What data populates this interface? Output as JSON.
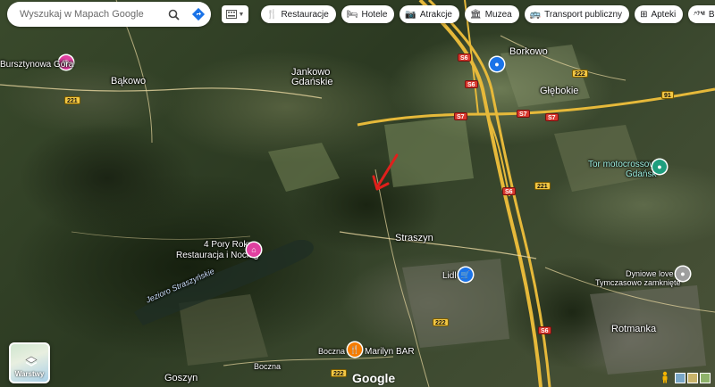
{
  "search": {
    "placeholder": "Wyszukaj w Mapach Google"
  },
  "chips": [
    {
      "label": "Restauracje",
      "icon": "fork-knife-icon"
    },
    {
      "label": "Hotele",
      "icon": "bed-icon"
    },
    {
      "label": "Atrakcje",
      "icon": "camera-icon"
    },
    {
      "label": "Muzea",
      "icon": "museum-icon"
    },
    {
      "label": "Transport publiczny",
      "icon": "bus-icon"
    },
    {
      "label": "Apteki",
      "icon": "pharmacy-icon"
    },
    {
      "label": "B",
      "icon": "atm-icon",
      "prefix": "ATM"
    }
  ],
  "places": {
    "bursztynowa_gora": "Bursztynowa Góra",
    "bakowo": "Bąkowo",
    "jankowo": "Jankowo",
    "gdanskie": "Gdańskie",
    "borkowo": "Borkowo",
    "glebokie": "Głębokie",
    "tor_moto_1": "Tor motocrossowy",
    "tor_moto_2": "Gdańsk",
    "straszyn": "Straszyn",
    "pory_roku_1": "4 Pory Roku",
    "pory_roku_2": "Restauracja i Nocleg",
    "lidl": "Lidl",
    "dyniowe_1": "Dyniowe love",
    "dyniowe_2": "Tymczasowo zamknięte",
    "jezioro": "Jezioro Straszyńskie",
    "rotmanka": "Rotmanka",
    "goszyn": "Goszyn",
    "marilyn": "Marilyn BAR",
    "boczna_1": "Boczna",
    "boczna_2": "Boczna"
  },
  "roads": {
    "r221a": "221",
    "r221b": "221",
    "r222a": "222",
    "r222b": "222",
    "r222c": "222",
    "s6a": "S6",
    "s6b": "S6",
    "s6c": "S6",
    "s6d": "S6",
    "s7a": "S7",
    "s7b": "S7",
    "s7c": "S7",
    "r91": "91"
  },
  "controls": {
    "layers_label": "Warstwy",
    "logo": "Google"
  },
  "colors": {
    "highway": "#f2c744",
    "poi_pink": "#e040a0",
    "poi_blue": "#1a73e8",
    "poi_orange": "#f57c00",
    "poi_teal": "#1e9e7e",
    "marker_arrow": "#e0201c"
  }
}
